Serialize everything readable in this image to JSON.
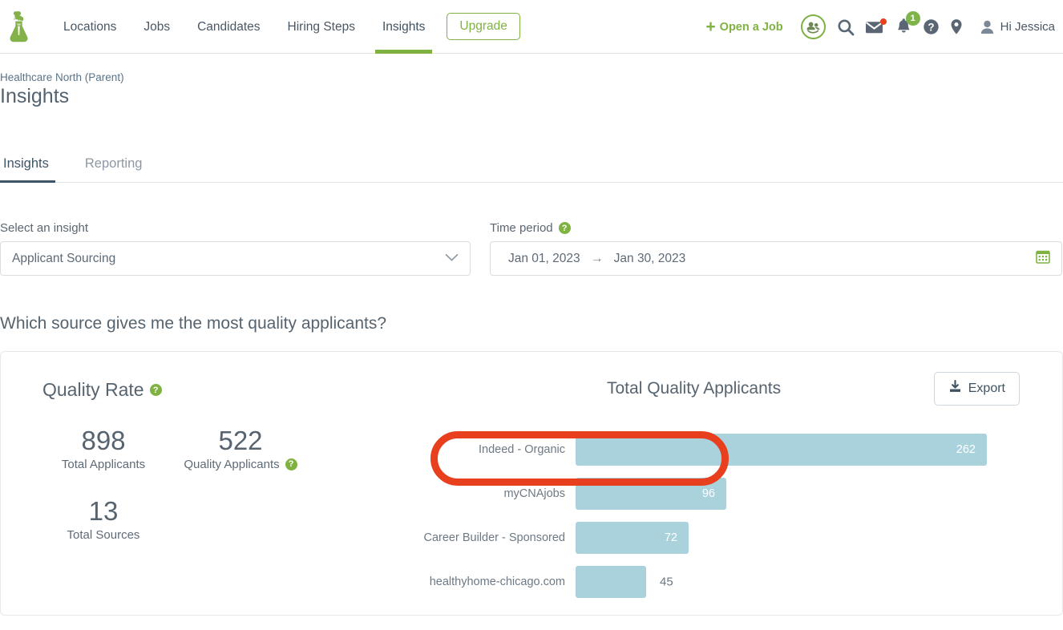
{
  "nav": {
    "logo_icon": "flask-logo-icon",
    "links": [
      {
        "label": "Locations",
        "active": false
      },
      {
        "label": "Jobs",
        "active": false
      },
      {
        "label": "Candidates",
        "active": false
      },
      {
        "label": "Hiring Steps",
        "active": false
      },
      {
        "label": "Insights",
        "active": true
      }
    ],
    "upgrade_label": "Upgrade",
    "open_job_label": "Open a Job",
    "open_job_icon": "plus-icon",
    "icons": [
      {
        "name": "people-circle-icon"
      },
      {
        "name": "search-icon"
      },
      {
        "name": "mail-icon",
        "dot": true
      },
      {
        "name": "bell-icon",
        "badge": "1"
      },
      {
        "name": "help-icon"
      },
      {
        "name": "location-pin-icon"
      }
    ],
    "user_label": "Hi Jessica",
    "user_icon": "person-icon"
  },
  "page": {
    "breadcrumb": "Healthcare North (Parent)",
    "title": "Insights",
    "tabs": [
      {
        "label": "Insights",
        "active": true
      },
      {
        "label": "Reporting",
        "active": false
      }
    ]
  },
  "filters": {
    "insight": {
      "label": "Select an insight",
      "value": "Applicant Sourcing",
      "chevron_icon": "chevron-down-icon"
    },
    "time_period": {
      "label": "Time period",
      "help_icon": "help-circle-icon",
      "start": "Jan 01, 2023",
      "arrow": "→",
      "end": "Jan 30, 2023",
      "calendar_icon": "calendar-icon"
    }
  },
  "main": {
    "question": "Which source gives me the most quality applicants?",
    "quality_rate": {
      "title": "Quality Rate",
      "help_icon": "help-circle-icon",
      "stats": [
        {
          "value": "898",
          "label": "Total Applicants",
          "has_help": false
        },
        {
          "value": "522",
          "label": "Quality Applicants",
          "has_help": true
        },
        {
          "value": "13",
          "label": "Total Sources",
          "has_help": false
        }
      ]
    },
    "export_label": "Export",
    "export_icon": "download-icon"
  },
  "chart_data": {
    "type": "bar",
    "orientation": "horizontal",
    "title": "Total Quality Applicants",
    "xlabel": "",
    "ylabel": "",
    "categories": [
      "Indeed - Organic",
      "myCNAjobs",
      "Career Builder - Sponsored",
      "healthyhome-chicago.com"
    ],
    "values": [
      262,
      96,
      72,
      45
    ],
    "value_label_inside": [
      true,
      true,
      true,
      false
    ],
    "xlim": [
      0,
      262
    ],
    "grid": false,
    "legend": "none",
    "bar_color": "#a9d2dd",
    "annotation": {
      "type": "highlight-oval",
      "target_category": "myCNAjobs",
      "color": "#e8401f"
    }
  },
  "colors": {
    "brand_green": "#7fb241",
    "slate": "#4a5764",
    "bar": "#a9d2dd",
    "annotation_red": "#e8401f",
    "badge_green": "#7fb44b"
  }
}
